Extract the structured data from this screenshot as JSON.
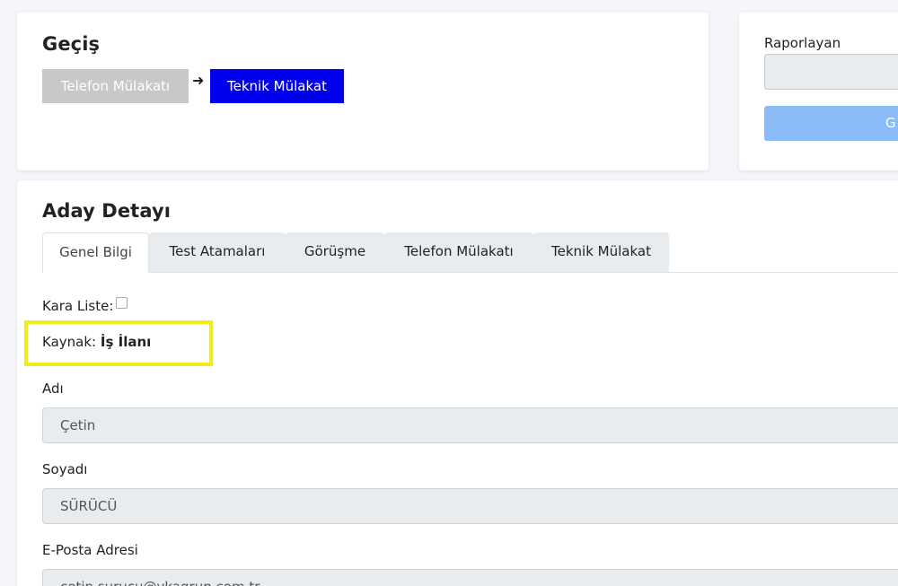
{
  "transition": {
    "title": "Geçiş",
    "stages": [
      "Telefon Mülakatı",
      "Teknik Mülakat"
    ],
    "arrow": "➜"
  },
  "report": {
    "label": "Raporlayan",
    "input_value": "",
    "button_label": "G"
  },
  "candidate": {
    "title": "Aday Detayı",
    "tabs": [
      "Genel Bilgi",
      "Test Atamaları",
      "Görüşme",
      "Telefon Mülakatı",
      "Teknik Mülakat"
    ],
    "active_tab": "Genel Bilgi",
    "blacklist_label": "Kara Liste:",
    "blacklist_checked": false,
    "source_label": "Kaynak:",
    "source_value": "İş İlanı",
    "fields": [
      {
        "label": "Adı",
        "value": "Çetin"
      },
      {
        "label": "Soyadı",
        "value": "SÜRÜCÜ"
      },
      {
        "label": "E-Posta Adresi",
        "value": "cetin.surucu@ykagrup.com.tr"
      }
    ]
  },
  "colors": {
    "active_stage": "#0000ee",
    "inactive_stage": "#c8c8c8",
    "highlight": "#f0ec1a",
    "report_button": "#8cbcf7"
  }
}
